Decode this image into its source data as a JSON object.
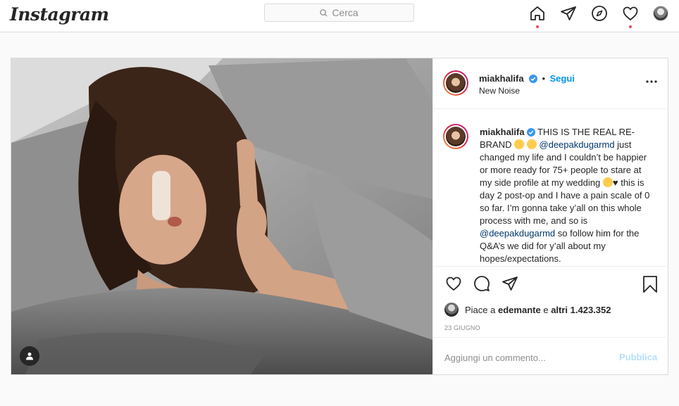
{
  "nav": {
    "logo": "Instagram",
    "search_placeholder": "Cerca",
    "icons": [
      "home-icon",
      "direct-icon",
      "explore-icon",
      "activity-icon",
      "profile-avatar"
    ]
  },
  "post": {
    "header": {
      "username": "miakhalifa",
      "separator": "•",
      "follow_label": "Segui",
      "subtitle": "New Noise",
      "more_icon": "more-options-icon"
    },
    "caption": {
      "username": "miakhalifa",
      "text_1": "THIS IS THE REAL RE-BRAND",
      "mention_1": "@deepakdugarmd",
      "text_2": "just changed my life and I couldn’t be happier or more ready for 75+ people to stare at my side profile at my wedding",
      "text_3": "this is day 2 post-op and I have a pain scale of 0 so far. I’m gonna take y’all on this whole process with me, and so is",
      "mention_2": "@deepakdugarmd",
      "text_4": "so follow him for the Q&A’s we did for y’all about my hopes/expectations."
    },
    "likes": {
      "prefix": "Piace a",
      "user": "edemante",
      "middle": "e",
      "others": "altri 1.423.352"
    },
    "date": "23 GIUGNO",
    "comment": {
      "placeholder": "Aggiungi un commento...",
      "publish_label": "Pubblica"
    }
  },
  "colors": {
    "accent": "#0095f6",
    "publish_disabled": "#b2dffc",
    "notification_dot": "#ed4956",
    "border": "#dbdbdb"
  }
}
